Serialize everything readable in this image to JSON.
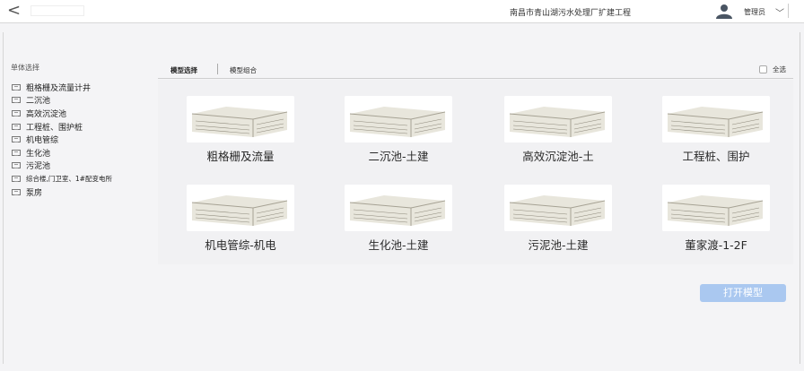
{
  "header": {
    "back_glyph": "<",
    "project_title": "南昌市青山湖污水处理厂扩建工程",
    "user_name": "管理员",
    "dropdown_glyph": "﹀"
  },
  "sidebar": {
    "title": "单体选择",
    "items": [
      {
        "label": "粗格栅及流量计井"
      },
      {
        "label": "二沉池"
      },
      {
        "label": "高效沉淀池"
      },
      {
        "label": "工程桩、围护桩"
      },
      {
        "label": "机电管综"
      },
      {
        "label": "生化池"
      },
      {
        "label": "污泥池"
      },
      {
        "label": "综合楼,门卫室、1#配变电所"
      },
      {
        "label": "泵房"
      }
    ]
  },
  "tabs": {
    "items": [
      {
        "label": "模型选择",
        "active": true
      },
      {
        "label": "模型组合",
        "active": false
      }
    ],
    "select_all": "全选"
  },
  "models": [
    {
      "label": "粗格栅及流量"
    },
    {
      "label": "二沉池-土建"
    },
    {
      "label": "高效沉淀池-土"
    },
    {
      "label": "工程桩、围护"
    },
    {
      "label": "机电管综-机电"
    },
    {
      "label": "生化池-土建"
    },
    {
      "label": "污泥池-土建"
    },
    {
      "label": "董家渡-1-2F"
    }
  ],
  "actions": {
    "open_model": "打开模型"
  },
  "colors": {
    "accent_button": "#aac8f0",
    "header_bg": "#ffffff",
    "page_bg": "#f4f4f6"
  }
}
